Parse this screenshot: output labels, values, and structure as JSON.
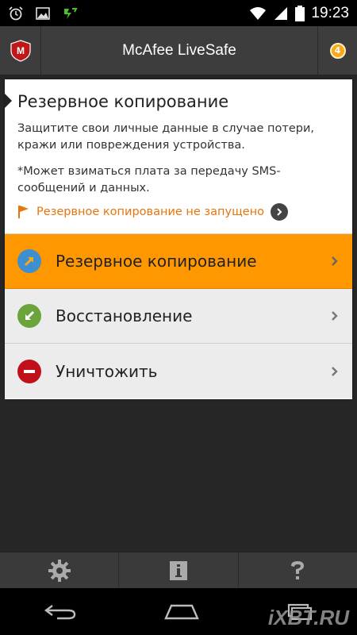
{
  "status_bar": {
    "time": "19:23",
    "icons": [
      "alarm-icon",
      "image-icon",
      "charge-icon",
      "wifi-icon",
      "signal-icon",
      "battery-icon"
    ]
  },
  "app_bar": {
    "title": "McAfee LiveSafe",
    "logo_letter": "M",
    "badge_count": "4"
  },
  "card": {
    "title": "Резервное копирование",
    "description": "Защитите свои личные данные в случае потери, кражи или повреждения устройства.",
    "note": "*Может взиматься плата за передачу SMS-сообщений и данных.",
    "status": "Резервное копирование не запущено",
    "menu": [
      {
        "label": "Резервное копирование",
        "icon": "arrow-up-right-icon",
        "color": "#3d8fcf",
        "active": true
      },
      {
        "label": "Восстановление",
        "icon": "arrow-down-left-icon",
        "color": "#6aa43a",
        "active": false
      },
      {
        "label": "Уничтожить",
        "icon": "minus-circle-icon",
        "color": "#c0111a",
        "active": false
      }
    ]
  },
  "bottom_bar": {
    "items": [
      "gear-icon",
      "info-icon",
      "help-icon"
    ]
  },
  "colors": {
    "accent": "#ff9800",
    "status_text": "#e8740c",
    "badge": "#f7a81c",
    "mcafee_red": "#c01818"
  },
  "watermark": "iXBT.RU"
}
